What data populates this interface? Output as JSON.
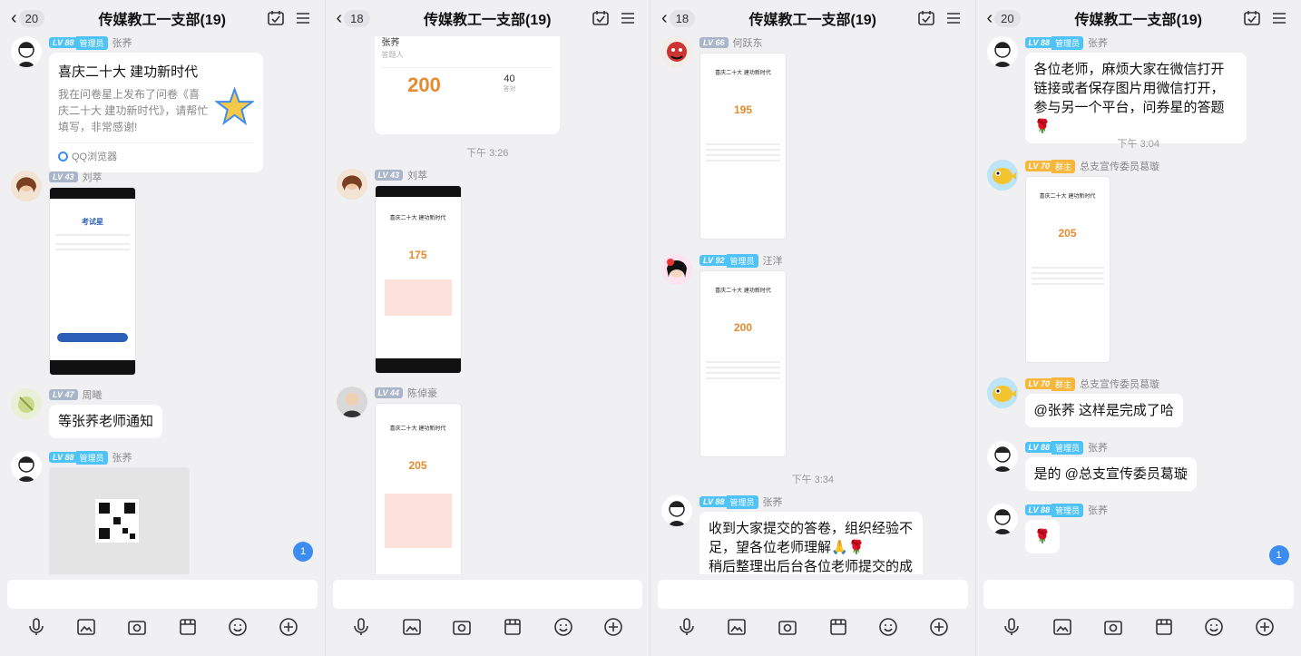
{
  "panels": [
    {
      "back_count": "20",
      "title": "传媒教工一支部(19)",
      "messages": {
        "m1": {
          "level": "LV 88",
          "role": "管理员",
          "name": "张荞"
        },
        "card": {
          "title": "喜庆二十大 建功新时代",
          "desc": "我在问卷星上发布了问卷《喜庆二十大 建功新时代》，请帮忙填写，非常感谢!",
          "source": "QQ浏览器"
        },
        "m2": {
          "level": "LV 43",
          "name": "刘萃"
        },
        "m3": {
          "level": "LV 47",
          "name": "周曦",
          "text": "等张荞老师通知"
        },
        "m4": {
          "level": "LV 88",
          "role": "管理员",
          "name": "张荞"
        }
      },
      "unread_badge": "1"
    },
    {
      "back_count": "18",
      "title": "传媒教工一支部(19)",
      "messages": {
        "top_card": {
          "name": "张荞",
          "sub": "答题人",
          "score": "200",
          "right": "40",
          "right_sub": "答对"
        },
        "time": "下午 3:26",
        "m1": {
          "level": "LV 43",
          "name": "刘萃"
        },
        "m2": {
          "level": "LV 44",
          "name": "陈倬豪"
        }
      }
    },
    {
      "back_count": "18",
      "title": "传媒教工一支部(19)",
      "messages": {
        "m1": {
          "level": "LV 66",
          "name": "何跃东"
        },
        "m2": {
          "level": "LV 92",
          "role": "管理员",
          "name": "汪洋"
        },
        "time": "下午 3:34",
        "m3": {
          "level": "LV 88",
          "role": "管理员",
          "name": "张荞",
          "text": "收到大家提交的答卷，组织经验不足，望各位老师理解🙏🌹\n稍后整理出后台各位老师提交的成绩"
        }
      }
    },
    {
      "back_count": "20",
      "title": "传媒教工一支部(19)",
      "messages": {
        "m1": {
          "level": "LV 88",
          "role": "管理员",
          "name": "张荞",
          "text": "各位老师，麻烦大家在微信打开链接或者保存图片用微信打开，参与另一个平台，问券星的答题🌹"
        },
        "time": "下午 3:04",
        "m2": {
          "level": "LV 70",
          "role": "群主",
          "name": "总支宣传委员葛璇"
        },
        "m3": {
          "level": "LV 70",
          "role": "群主",
          "name": "总支宣传委员葛璇",
          "text": "@张荞 这样是完成了哈"
        },
        "m4": {
          "level": "LV 88",
          "role": "管理员",
          "name": "张荞",
          "text": "是的 @总支宣传委员葛璇"
        },
        "m5": {
          "level": "LV 88",
          "role": "管理员",
          "name": "张荞",
          "text": "🌹"
        }
      },
      "unread_badge": "1"
    }
  ],
  "screenshot_text": {
    "quiz_title": "喜庆二十大 建功新时代",
    "app_name": "考试星"
  },
  "icons": [
    "back-chevron-icon",
    "calendar-check-icon",
    "menu-icon",
    "mic-icon",
    "image-icon",
    "camera-icon",
    "box-icon",
    "emoji-icon",
    "plus-icon"
  ],
  "colors": {
    "accent": "#3d8cf0",
    "admin": "#4fc3f7",
    "owner": "#f6b73c",
    "score": "#e58a2e"
  }
}
